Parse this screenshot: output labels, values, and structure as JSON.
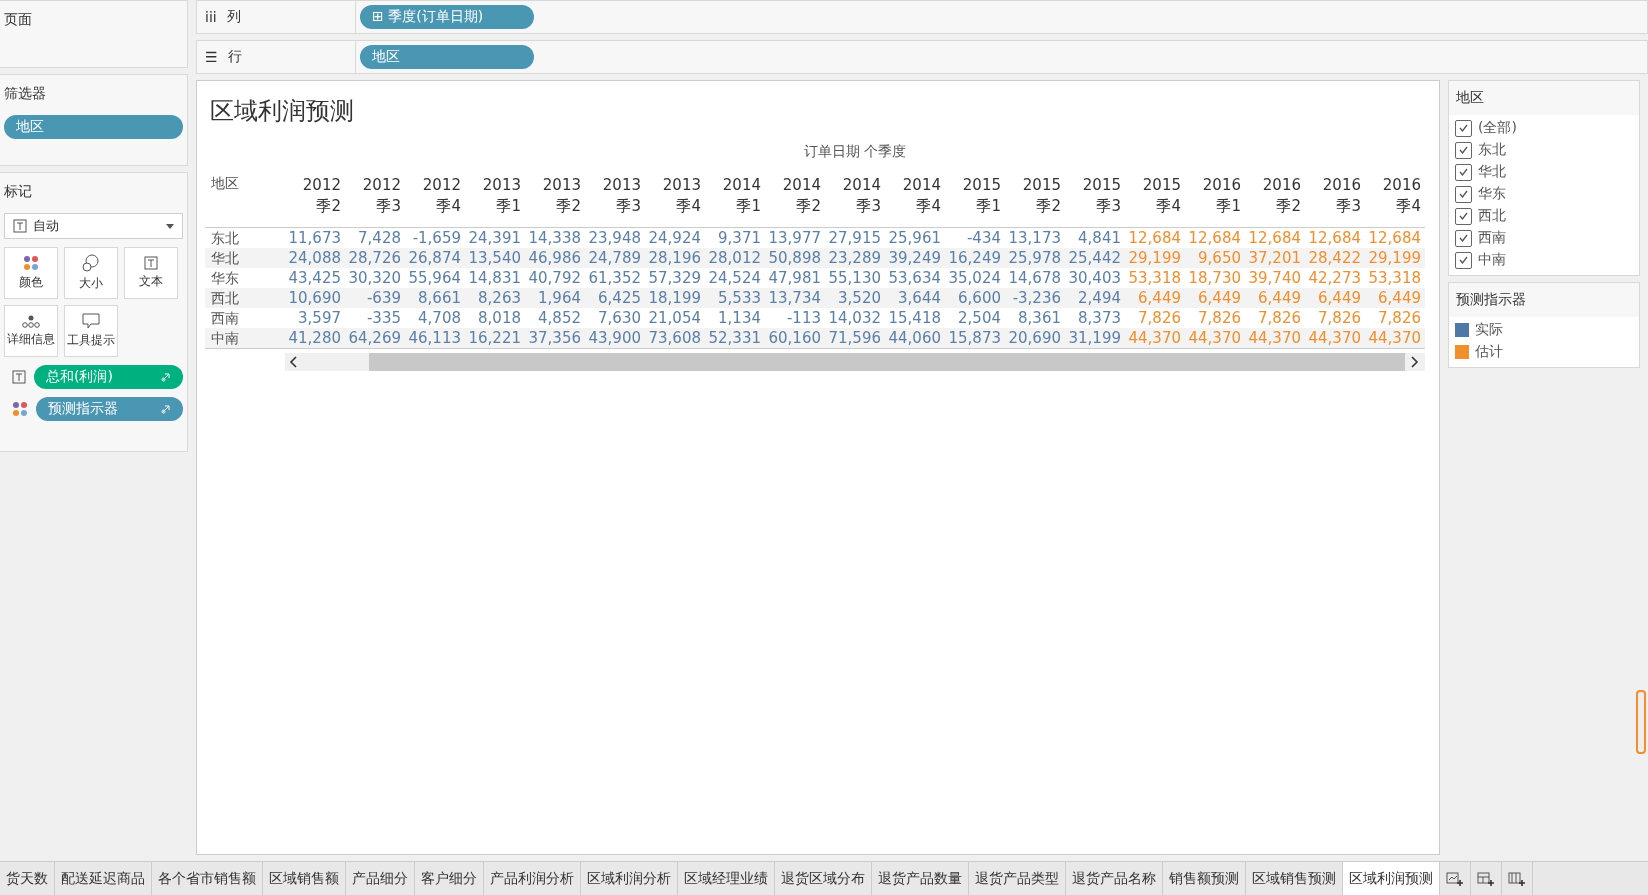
{
  "pages_card": {
    "title": "页面"
  },
  "shelves": [
    {
      "icon": "iii",
      "label": "列",
      "pill": "⊞ 季度(订单日期)"
    },
    {
      "icon": "☰",
      "label": "行",
      "pill": "地区"
    }
  ],
  "filters_card": {
    "title": "筛选器",
    "pills": [
      "地区"
    ]
  },
  "marks_card": {
    "title": "标记",
    "mark_type": "自动",
    "buttons": [
      {
        "kind": "color",
        "label": "颜色"
      },
      {
        "kind": "size",
        "label": "大小"
      },
      {
        "kind": "text",
        "label": "文本"
      },
      {
        "kind": "detail",
        "label": "详细信息"
      },
      {
        "kind": "tooltip",
        "label": "工具提示"
      }
    ],
    "fields": [
      {
        "kind": "text",
        "label": "总和(利润)",
        "color": "#00b180"
      },
      {
        "kind": "color",
        "label": "预测指示器",
        "color": "#4a97b4"
      }
    ]
  },
  "view": {
    "title": "区域利润预测",
    "column_header": "订单日期 个季度",
    "row_header": "地区",
    "columns": [
      {
        "year": "2012",
        "quarter": "季2",
        "forecast": false
      },
      {
        "year": "2012",
        "quarter": "季3",
        "forecast": false
      },
      {
        "year": "2012",
        "quarter": "季4",
        "forecast": false
      },
      {
        "year": "2013",
        "quarter": "季1",
        "forecast": false
      },
      {
        "year": "2013",
        "quarter": "季2",
        "forecast": false
      },
      {
        "year": "2013",
        "quarter": "季3",
        "forecast": false
      },
      {
        "year": "2013",
        "quarter": "季4",
        "forecast": false
      },
      {
        "year": "2014",
        "quarter": "季1",
        "forecast": false
      },
      {
        "year": "2014",
        "quarter": "季2",
        "forecast": false
      },
      {
        "year": "2014",
        "quarter": "季3",
        "forecast": false
      },
      {
        "year": "2014",
        "quarter": "季4",
        "forecast": false
      },
      {
        "year": "2015",
        "quarter": "季1",
        "forecast": false
      },
      {
        "year": "2015",
        "quarter": "季2",
        "forecast": false
      },
      {
        "year": "2015",
        "quarter": "季3",
        "forecast": false
      },
      {
        "year": "2015",
        "quarter": "季4",
        "forecast": true
      },
      {
        "year": "2016",
        "quarter": "季1",
        "forecast": true
      },
      {
        "year": "2016",
        "quarter": "季2",
        "forecast": true
      },
      {
        "year": "2016",
        "quarter": "季3",
        "forecast": true
      },
      {
        "year": "2016",
        "quarter": "季4",
        "forecast": true
      }
    ],
    "rows": [
      {
        "region": "东北",
        "values": [
          "11,673",
          "7,428",
          "-1,659",
          "24,391",
          "14,338",
          "23,948",
          "24,924",
          "9,371",
          "13,977",
          "27,915",
          "25,961",
          "-434",
          "13,173",
          "4,841",
          "12,684",
          "12,684",
          "12,684",
          "12,684",
          "12,684"
        ]
      },
      {
        "region": "华北",
        "values": [
          "24,088",
          "28,726",
          "26,874",
          "13,540",
          "46,986",
          "24,789",
          "28,196",
          "28,012",
          "50,898",
          "23,289",
          "39,249",
          "16,249",
          "25,978",
          "25,442",
          "29,199",
          "9,650",
          "37,201",
          "28,422",
          "29,199"
        ]
      },
      {
        "region": "华东",
        "values": [
          "43,425",
          "30,320",
          "55,964",
          "14,831",
          "40,792",
          "61,352",
          "57,329",
          "24,524",
          "47,981",
          "55,130",
          "53,634",
          "35,024",
          "14,678",
          "30,403",
          "53,318",
          "18,730",
          "39,740",
          "42,273",
          "53,318"
        ]
      },
      {
        "region": "西北",
        "values": [
          "10,690",
          "-639",
          "8,661",
          "8,263",
          "1,964",
          "6,425",
          "18,199",
          "5,533",
          "13,734",
          "3,520",
          "3,644",
          "6,600",
          "-3,236",
          "2,494",
          "6,449",
          "6,449",
          "6,449",
          "6,449",
          "6,449"
        ]
      },
      {
        "region": "西南",
        "values": [
          "3,597",
          "-335",
          "4,708",
          "8,018",
          "4,852",
          "7,630",
          "21,054",
          "1,134",
          "-113",
          "14,032",
          "15,418",
          "2,504",
          "8,361",
          "8,373",
          "7,826",
          "7,826",
          "7,826",
          "7,826",
          "7,826"
        ]
      },
      {
        "region": "中南",
        "values": [
          "41,280",
          "64,269",
          "46,113",
          "16,221",
          "37,356",
          "43,900",
          "73,608",
          "52,331",
          "60,160",
          "71,596",
          "44,060",
          "15,873",
          "20,690",
          "31,199",
          "44,370",
          "44,370",
          "44,370",
          "44,370",
          "44,370"
        ]
      }
    ]
  },
  "region_filter": {
    "title": "地区",
    "items": [
      {
        "label": "(全部)",
        "checked": true
      },
      {
        "label": "东北",
        "checked": true
      },
      {
        "label": "华北",
        "checked": true
      },
      {
        "label": "华东",
        "checked": true
      },
      {
        "label": "西北",
        "checked": true
      },
      {
        "label": "西南",
        "checked": true
      },
      {
        "label": "中南",
        "checked": true
      }
    ]
  },
  "legend": {
    "title": "预测指示器",
    "items": [
      {
        "label": "实际",
        "color": "#4e79a7"
      },
      {
        "label": "估计",
        "color": "#f28e2b"
      }
    ]
  },
  "sheet_tabs": [
    {
      "label": "货天数",
      "selected": false
    },
    {
      "label": "配送延迟商品",
      "selected": false
    },
    {
      "label": "各个省市销售额",
      "selected": false
    },
    {
      "label": "区域销售额",
      "selected": false
    },
    {
      "label": "产品细分",
      "selected": false
    },
    {
      "label": "客户细分",
      "selected": false
    },
    {
      "label": "产品利润分析",
      "selected": false
    },
    {
      "label": "区域利润分析",
      "selected": false
    },
    {
      "label": "区域经理业绩",
      "selected": false
    },
    {
      "label": "退货区域分布",
      "selected": false
    },
    {
      "label": "退货产品数量",
      "selected": false
    },
    {
      "label": "退货产品类型",
      "selected": false
    },
    {
      "label": "退货产品名称",
      "selected": false
    },
    {
      "label": "销售额预测",
      "selected": false
    },
    {
      "label": "区域销售预测",
      "selected": false
    },
    {
      "label": "区域利润预测",
      "selected": true
    }
  ]
}
